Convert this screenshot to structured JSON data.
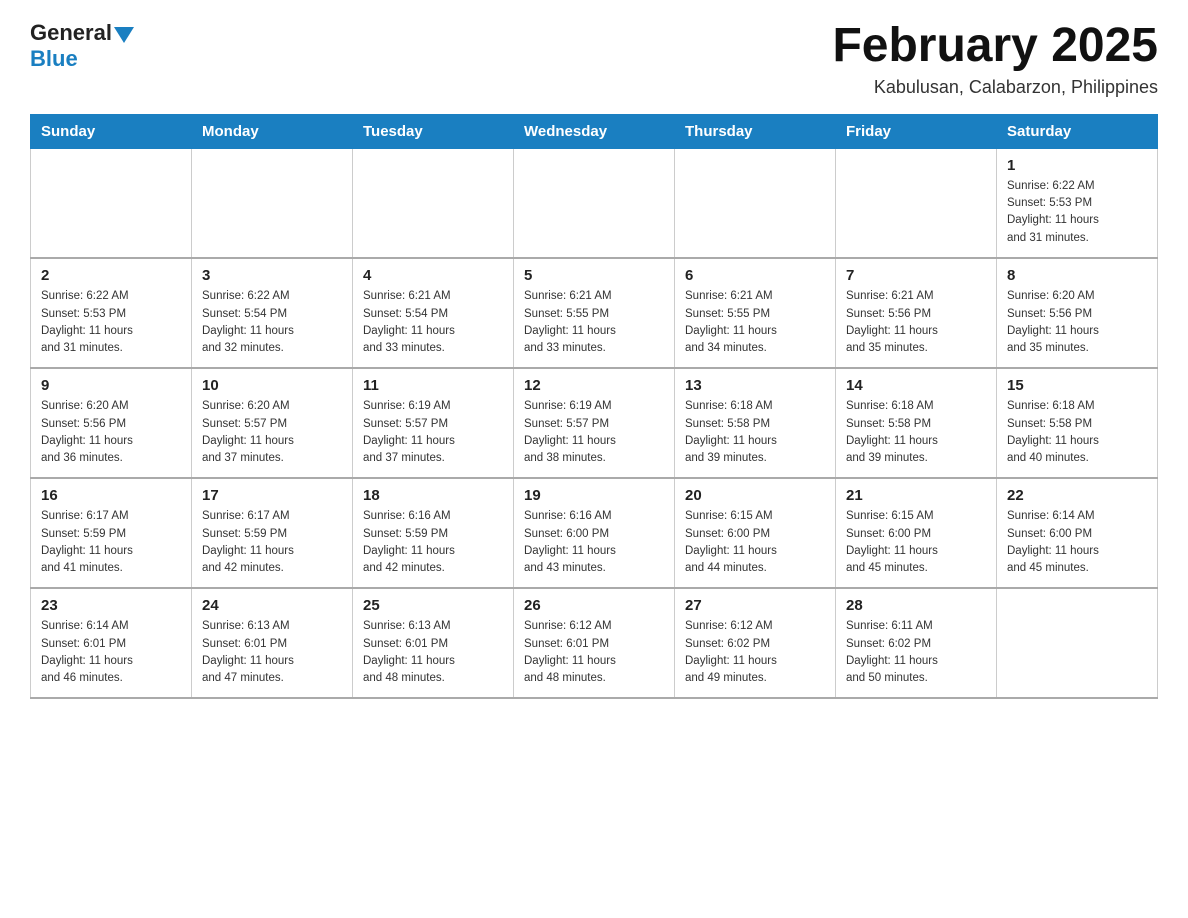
{
  "logo": {
    "general": "General",
    "blue": "Blue"
  },
  "title": {
    "month_year": "February 2025",
    "location": "Kabulusan, Calabarzon, Philippines"
  },
  "weekdays": [
    "Sunday",
    "Monday",
    "Tuesday",
    "Wednesday",
    "Thursday",
    "Friday",
    "Saturday"
  ],
  "weeks": [
    [
      {
        "day": "",
        "info": ""
      },
      {
        "day": "",
        "info": ""
      },
      {
        "day": "",
        "info": ""
      },
      {
        "day": "",
        "info": ""
      },
      {
        "day": "",
        "info": ""
      },
      {
        "day": "",
        "info": ""
      },
      {
        "day": "1",
        "info": "Sunrise: 6:22 AM\nSunset: 5:53 PM\nDaylight: 11 hours\nand 31 minutes."
      }
    ],
    [
      {
        "day": "2",
        "info": "Sunrise: 6:22 AM\nSunset: 5:53 PM\nDaylight: 11 hours\nand 31 minutes."
      },
      {
        "day": "3",
        "info": "Sunrise: 6:22 AM\nSunset: 5:54 PM\nDaylight: 11 hours\nand 32 minutes."
      },
      {
        "day": "4",
        "info": "Sunrise: 6:21 AM\nSunset: 5:54 PM\nDaylight: 11 hours\nand 33 minutes."
      },
      {
        "day": "5",
        "info": "Sunrise: 6:21 AM\nSunset: 5:55 PM\nDaylight: 11 hours\nand 33 minutes."
      },
      {
        "day": "6",
        "info": "Sunrise: 6:21 AM\nSunset: 5:55 PM\nDaylight: 11 hours\nand 34 minutes."
      },
      {
        "day": "7",
        "info": "Sunrise: 6:21 AM\nSunset: 5:56 PM\nDaylight: 11 hours\nand 35 minutes."
      },
      {
        "day": "8",
        "info": "Sunrise: 6:20 AM\nSunset: 5:56 PM\nDaylight: 11 hours\nand 35 minutes."
      }
    ],
    [
      {
        "day": "9",
        "info": "Sunrise: 6:20 AM\nSunset: 5:56 PM\nDaylight: 11 hours\nand 36 minutes."
      },
      {
        "day": "10",
        "info": "Sunrise: 6:20 AM\nSunset: 5:57 PM\nDaylight: 11 hours\nand 37 minutes."
      },
      {
        "day": "11",
        "info": "Sunrise: 6:19 AM\nSunset: 5:57 PM\nDaylight: 11 hours\nand 37 minutes."
      },
      {
        "day": "12",
        "info": "Sunrise: 6:19 AM\nSunset: 5:57 PM\nDaylight: 11 hours\nand 38 minutes."
      },
      {
        "day": "13",
        "info": "Sunrise: 6:18 AM\nSunset: 5:58 PM\nDaylight: 11 hours\nand 39 minutes."
      },
      {
        "day": "14",
        "info": "Sunrise: 6:18 AM\nSunset: 5:58 PM\nDaylight: 11 hours\nand 39 minutes."
      },
      {
        "day": "15",
        "info": "Sunrise: 6:18 AM\nSunset: 5:58 PM\nDaylight: 11 hours\nand 40 minutes."
      }
    ],
    [
      {
        "day": "16",
        "info": "Sunrise: 6:17 AM\nSunset: 5:59 PM\nDaylight: 11 hours\nand 41 minutes."
      },
      {
        "day": "17",
        "info": "Sunrise: 6:17 AM\nSunset: 5:59 PM\nDaylight: 11 hours\nand 42 minutes."
      },
      {
        "day": "18",
        "info": "Sunrise: 6:16 AM\nSunset: 5:59 PM\nDaylight: 11 hours\nand 42 minutes."
      },
      {
        "day": "19",
        "info": "Sunrise: 6:16 AM\nSunset: 6:00 PM\nDaylight: 11 hours\nand 43 minutes."
      },
      {
        "day": "20",
        "info": "Sunrise: 6:15 AM\nSunset: 6:00 PM\nDaylight: 11 hours\nand 44 minutes."
      },
      {
        "day": "21",
        "info": "Sunrise: 6:15 AM\nSunset: 6:00 PM\nDaylight: 11 hours\nand 45 minutes."
      },
      {
        "day": "22",
        "info": "Sunrise: 6:14 AM\nSunset: 6:00 PM\nDaylight: 11 hours\nand 45 minutes."
      }
    ],
    [
      {
        "day": "23",
        "info": "Sunrise: 6:14 AM\nSunset: 6:01 PM\nDaylight: 11 hours\nand 46 minutes."
      },
      {
        "day": "24",
        "info": "Sunrise: 6:13 AM\nSunset: 6:01 PM\nDaylight: 11 hours\nand 47 minutes."
      },
      {
        "day": "25",
        "info": "Sunrise: 6:13 AM\nSunset: 6:01 PM\nDaylight: 11 hours\nand 48 minutes."
      },
      {
        "day": "26",
        "info": "Sunrise: 6:12 AM\nSunset: 6:01 PM\nDaylight: 11 hours\nand 48 minutes."
      },
      {
        "day": "27",
        "info": "Sunrise: 6:12 AM\nSunset: 6:02 PM\nDaylight: 11 hours\nand 49 minutes."
      },
      {
        "day": "28",
        "info": "Sunrise: 6:11 AM\nSunset: 6:02 PM\nDaylight: 11 hours\nand 50 minutes."
      },
      {
        "day": "",
        "info": ""
      }
    ]
  ]
}
